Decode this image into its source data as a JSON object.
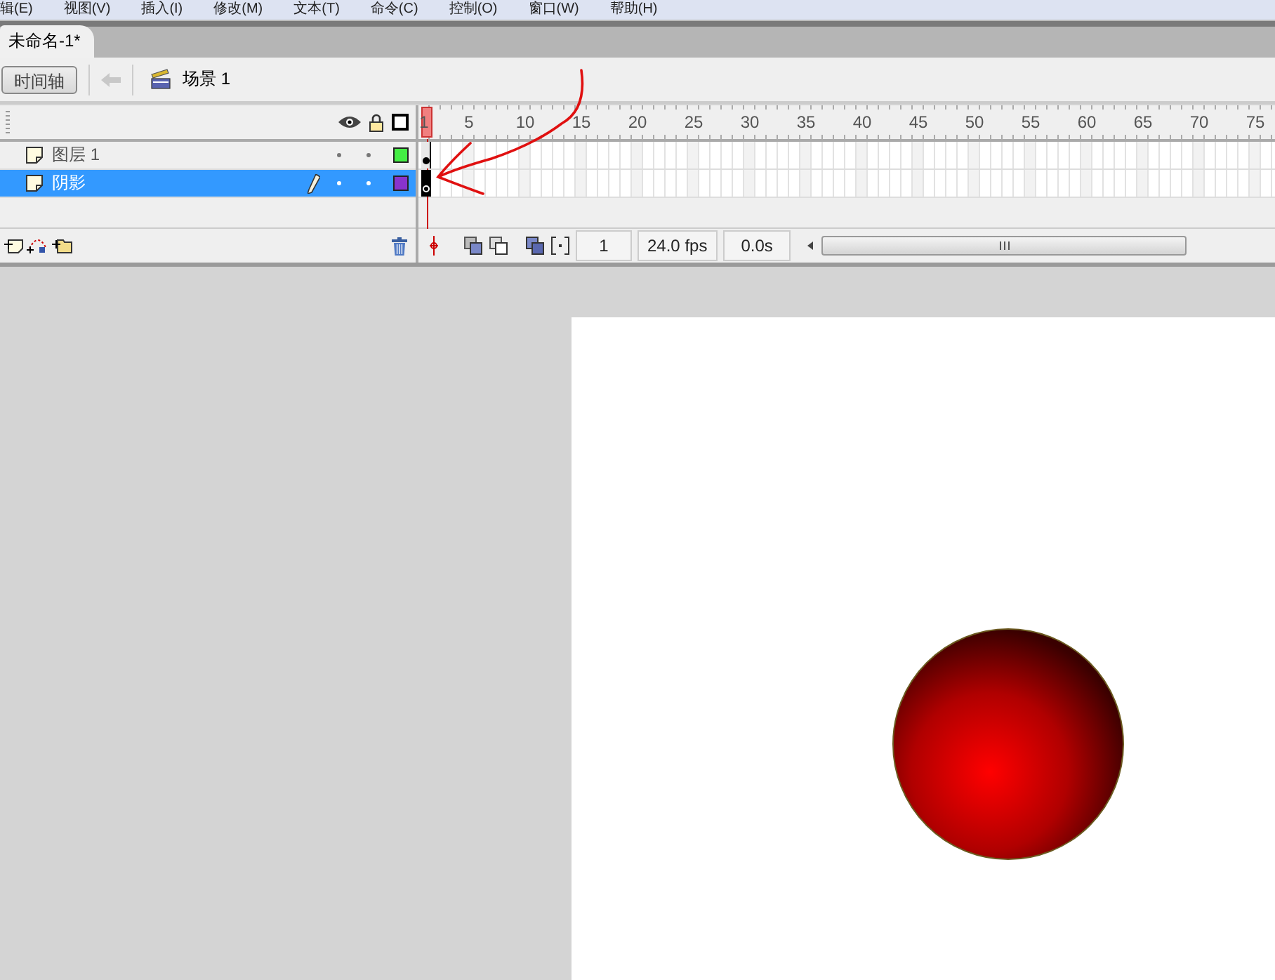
{
  "menu": [
    "辑(E)",
    "视图(V)",
    "插入(I)",
    "修改(M)",
    "文本(T)",
    "命令(C)",
    "控制(O)",
    "窗口(W)",
    "帮助(H)"
  ],
  "document_tabs": [
    {
      "label": "未命名-1*",
      "selected": true
    }
  ],
  "toolbar": {
    "timeline_button": "时间轴",
    "scene": "场景 1"
  },
  "timeline": {
    "ruler": [
      "1",
      "5",
      "10",
      "15",
      "20",
      "25",
      "30",
      "35",
      "40",
      "45",
      "50",
      "55",
      "60",
      "65",
      "70",
      "75"
    ],
    "layers": [
      {
        "name": "图层 1",
        "selected": false,
        "editing": false,
        "color": "#44ee44",
        "kind": "filled"
      },
      {
        "name": "阴影",
        "selected": true,
        "editing": true,
        "color": "#8833cc",
        "kind": "empty"
      }
    ],
    "status": {
      "frame": "1",
      "fps": "24.0 fps",
      "time": "0.0s"
    }
  }
}
